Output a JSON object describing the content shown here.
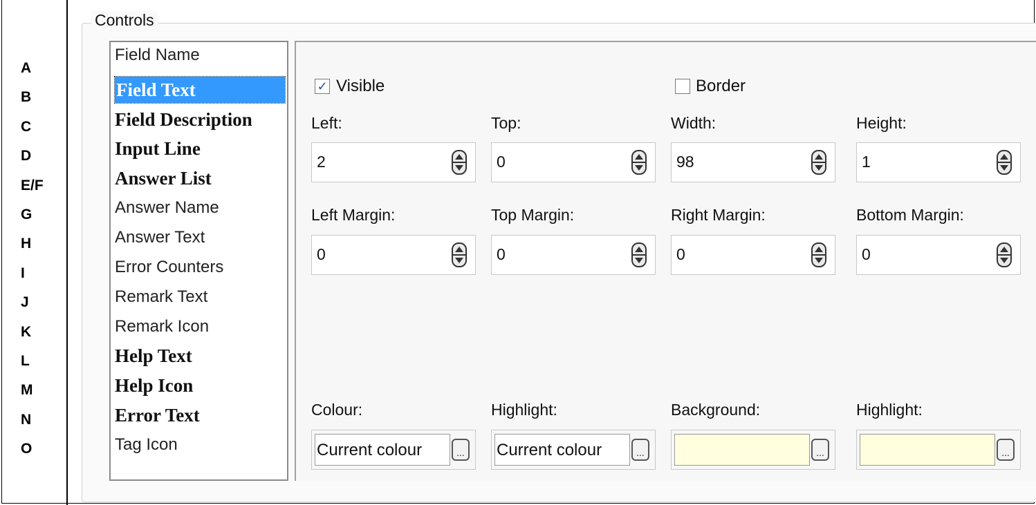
{
  "row_letters": [
    "A",
    "B",
    "C",
    "D",
    "E/F",
    "G",
    "H",
    "I",
    "J",
    "K",
    "L",
    "M",
    "N",
    "O"
  ],
  "group": {
    "title": "Controls"
  },
  "list": {
    "items": [
      {
        "label": "Field Name",
        "style": "normal"
      },
      {
        "label": "Field Text",
        "style": "bold",
        "selected": true
      },
      {
        "label": "Field Description",
        "style": "bold"
      },
      {
        "label": "Input Line",
        "style": "bold"
      },
      {
        "label": "Answer List",
        "style": "bold"
      },
      {
        "label": "Answer Name",
        "style": "normal"
      },
      {
        "label": "Answer Text",
        "style": "normal"
      },
      {
        "label": "Error Counters",
        "style": "normal"
      },
      {
        "label": "Remark Text",
        "style": "normal"
      },
      {
        "label": "Remark Icon",
        "style": "normal"
      },
      {
        "label": "Help Text",
        "style": "bold"
      },
      {
        "label": "Help Icon",
        "style": "bold"
      },
      {
        "label": "Error Text",
        "style": "bold"
      },
      {
        "label": "Tag Icon",
        "style": "normal"
      }
    ]
  },
  "checkboxes": {
    "visible": {
      "label": "Visible",
      "checked": true
    },
    "border": {
      "label": "Border",
      "checked": false
    }
  },
  "position": {
    "left": {
      "label": "Left:",
      "value": "2"
    },
    "top": {
      "label": "Top:",
      "value": "0"
    },
    "width": {
      "label": "Width:",
      "value": "98"
    },
    "height": {
      "label": "Height:",
      "value": "1"
    }
  },
  "margins": {
    "left": {
      "label": "Left Margin:",
      "value": "0"
    },
    "top": {
      "label": "Top Margin:",
      "value": "0"
    },
    "right": {
      "label": "Right Margin:",
      "value": "0"
    },
    "bottom": {
      "label": "Bottom Margin:",
      "value": "0"
    }
  },
  "colours": {
    "colour": {
      "label": "Colour:",
      "value": "Current colour",
      "fill": "#ffffff"
    },
    "highlight": {
      "label": "Highlight:",
      "value": "Current colour",
      "fill": "#ffffff"
    },
    "background": {
      "label": "Background:",
      "value": "",
      "fill": "#ffffe0"
    },
    "highlight2": {
      "label": "Highlight:",
      "value": "",
      "fill": "#ffffe0"
    },
    "button_label": "..."
  },
  "colors": {
    "selection": "#3399ff",
    "check": "#2a4fa8"
  }
}
